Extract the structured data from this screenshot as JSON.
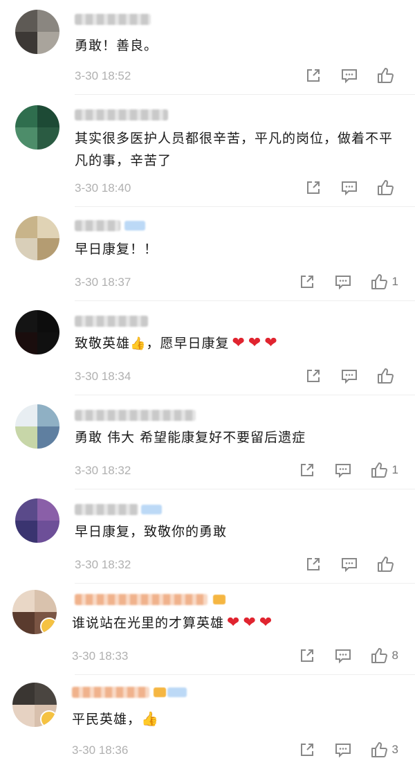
{
  "comments": [
    {
      "text": "勇敢！善良。",
      "time": "3-30 18:52",
      "likes": ""
    },
    {
      "text": "其实很多医护人员都很辛苦，平凡的岗位，做着不平凡的事，辛苦了",
      "time": "3-30 18:40",
      "likes": ""
    },
    {
      "text": "早日康复！！",
      "time": "3-30 18:37",
      "likes": "1"
    },
    {
      "text": "致敬英雄",
      "text_after": "，愿早日康复",
      "time": "3-30 18:34",
      "likes": ""
    },
    {
      "text": "勇敢 伟大 希望能康复好不要留后遗症",
      "time": "3-30 18:32",
      "likes": "1"
    },
    {
      "text": "早日康复，致敬你的勇敢",
      "time": "3-30 18:32",
      "likes": ""
    },
    {
      "text": "谁说站在光里的才算英雄",
      "time": "3-30 18:33",
      "likes": "8"
    },
    {
      "text": "平民英雄，",
      "time": "3-30 18:36",
      "likes": "3"
    }
  ],
  "icons": {
    "share": "share-icon",
    "comment": "comment-icon",
    "like": "thumbs-up-icon",
    "heart": "heart-emoji-icon",
    "thumb": "thumbs-up-emoji-icon"
  },
  "colors": {
    "heart": "#e0242f",
    "time": "#b0b0b0",
    "text": "#1a1a1a"
  }
}
